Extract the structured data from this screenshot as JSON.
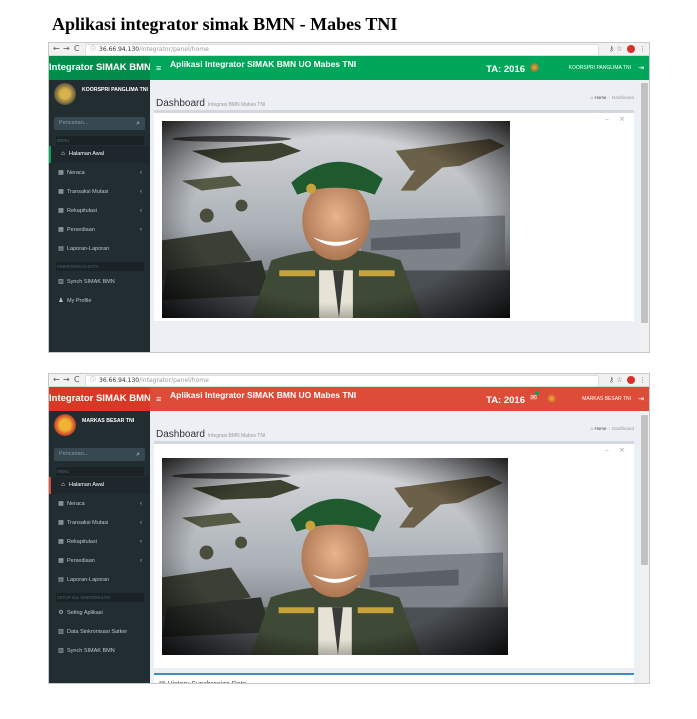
{
  "document_title": "Aplikasi integrator simak BMN - Mabes TNI",
  "browser": {
    "back": "←",
    "forward": "→",
    "reload": "C",
    "info": "ⓘ",
    "url_host": "36.66.94.130",
    "url_path": "/integrator/panel/home"
  },
  "screens": [
    {
      "theme_color": "#00a65a",
      "theme_dark": "#008d4c",
      "brand": "Integrator SIMAK BMN",
      "menu_toggle": "≡",
      "app_title": "Aplikasi Integrator SIMAK BMN UO Mabes TNI",
      "ta": "TA: 2016",
      "user": "KOORSPRI PANGLIMA TNI",
      "search_placeholder": "Pencarian...",
      "menu_header": "MENU",
      "nav": [
        {
          "icon": "home-icon",
          "glyph": "⌂",
          "label": "Halaman Awal",
          "arrow": ""
        },
        {
          "icon": "grid-icon",
          "glyph": "▦",
          "label": "Neraca",
          "arrow": "‹"
        },
        {
          "icon": "grid-icon",
          "glyph": "▦",
          "label": "Transaksi Mutasi",
          "arrow": "‹"
        },
        {
          "icon": "grid-icon",
          "glyph": "▦",
          "label": "Rekapitulasi",
          "arrow": "‹"
        },
        {
          "icon": "grid-icon",
          "glyph": "▦",
          "label": "Persediaan",
          "arrow": "‹"
        },
        {
          "icon": "file-icon",
          "glyph": "▤",
          "label": "Laporan-Laporan",
          "arrow": ""
        }
      ],
      "sync_header": "SINKRONISASI DATA",
      "nav2": [
        {
          "icon": "database-icon",
          "glyph": "▥",
          "label": "Synch SIMAK BMN"
        },
        {
          "icon": "user-icon",
          "glyph": "♟",
          "label": "My Profile"
        }
      ],
      "page_title": "Dashboard",
      "page_sub": "Integrasi BMN Mabes TNI",
      "crumb_home": "Home",
      "crumb_current": "Dashboard",
      "box_tools": "– ×"
    },
    {
      "theme_color": "#dd4b39",
      "theme_dark": "#d73925",
      "brand": "Integrator SIMAK BMN",
      "menu_toggle": "≡",
      "app_title": "Aplikasi Integrator SIMAK BMN UO Mabes TNI",
      "ta": "TA: 2016",
      "user": "MARKAS BESAR TNI",
      "search_placeholder": "Pencarian...",
      "menu_header": "MENU",
      "nav": [
        {
          "icon": "home-icon",
          "glyph": "⌂",
          "label": "Halaman Awal",
          "arrow": ""
        },
        {
          "icon": "grid-icon",
          "glyph": "▦",
          "label": "Neraca",
          "arrow": "‹"
        },
        {
          "icon": "grid-icon",
          "glyph": "▦",
          "label": "Transaksi Mutasi",
          "arrow": "‹"
        },
        {
          "icon": "grid-icon",
          "glyph": "▦",
          "label": "Rekapitulasi",
          "arrow": "‹"
        },
        {
          "icon": "grid-icon",
          "glyph": "▦",
          "label": "Persediaan",
          "arrow": "‹"
        },
        {
          "icon": "file-icon",
          "glyph": "▤",
          "label": "Laporan-Laporan",
          "arrow": ""
        }
      ],
      "sync_header": "SETUP dan SINKRONISASI",
      "nav2": [
        {
          "icon": "gears-icon",
          "glyph": "⚙",
          "label": "Seting Aplikasi"
        },
        {
          "icon": "database-icon",
          "glyph": "▥",
          "label": "Data Sinkronisasi Satker"
        },
        {
          "icon": "database-icon",
          "glyph": "▥",
          "label": "Synch SIMAK BMN"
        }
      ],
      "page_title": "Dashboard",
      "page_sub": "Integrasi BMN Mabes TNI",
      "crumb_home": "Home",
      "crumb_current": "Dashboard",
      "box_tools": "– ×",
      "history_icon": "▤",
      "history_title": "History Synchronize Data"
    }
  ]
}
